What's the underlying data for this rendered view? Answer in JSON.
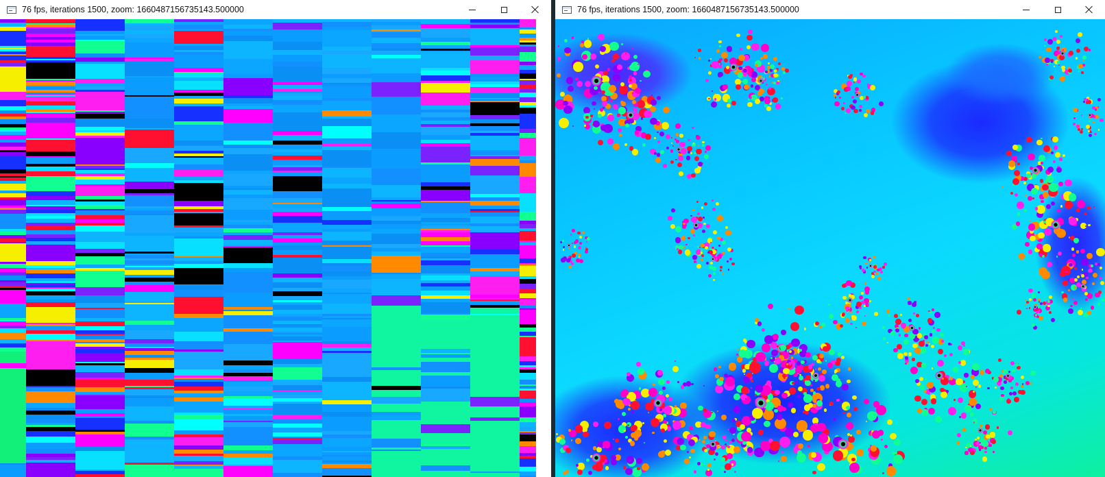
{
  "windows": [
    {
      "id": "left",
      "title": "76 fps, iterations 1500, zoom: 1660487156735143.500000",
      "controls": {
        "minimize": "minimize-icon",
        "maximize": "maximize-icon",
        "close": "close-icon"
      },
      "render": "glitched-column-bands"
    },
    {
      "id": "right",
      "title": "76 fps, iterations 1500, zoom: 1660487156735143.500000",
      "controls": {
        "minimize": "minimize-icon",
        "maximize": "maximize-icon",
        "close": "close-icon"
      },
      "render": "mandelbrot-spiral-fractal"
    }
  ],
  "palette": {
    "sky_blue": "#0aa6ff",
    "cyan": "#08e0ff",
    "magenta": "#ff1ef0",
    "violet": "#7a22ff",
    "blue": "#1530ff",
    "red": "#ff1030",
    "yellow": "#f6f000",
    "green": "#10ff90",
    "orange": "#ff8a00"
  }
}
